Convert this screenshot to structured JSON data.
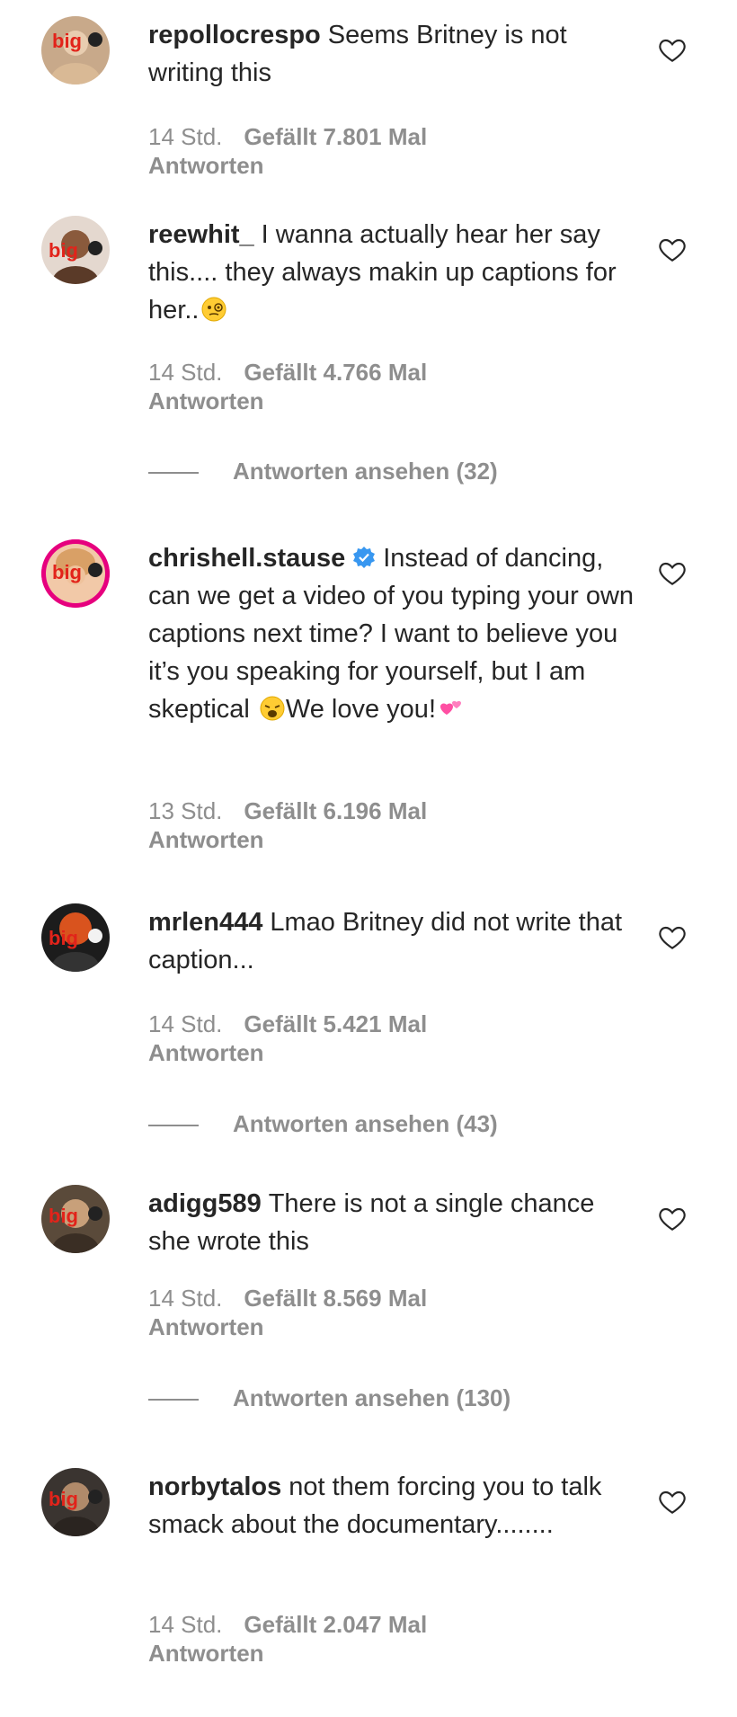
{
  "comments": [
    {
      "username": "repollocrespo",
      "text": "Seems Britney is not writing this",
      "time": "14 Std.",
      "likes": "Gefällt 7.801 Mal",
      "reply_label": "Antworten",
      "avatar_text": "big"
    },
    {
      "username": "reewhit_",
      "text": "I wanna actually hear her say this.... they always makin up captions for her..",
      "time": "14 Std.",
      "likes": "Gefällt 4.766 Mal",
      "reply_label": "Antworten",
      "view_replies": "Antworten ansehen (32)",
      "avatar_text": "big"
    },
    {
      "username": "chrishell.stause",
      "text_a": "Instead of dancing, can we get a video of you typing your own captions next time? I want to believe you it’s you speaking for yourself, but I am skeptical",
      "text_b": "We love you!",
      "time": "13 Std.",
      "likes": "Gefällt 6.196 Mal",
      "reply_label": "Antworten",
      "avatar_text": "big"
    },
    {
      "username": "mrlen444",
      "text": "Lmao Britney did not write that caption...",
      "time": "14 Std.",
      "likes": "Gefällt 5.421 Mal",
      "reply_label": "Antworten",
      "view_replies": "Antworten ansehen (43)",
      "avatar_text": "big"
    },
    {
      "username": "adigg589",
      "text": "There is not a single chance she wrote this",
      "time": "14 Std.",
      "likes": "Gefällt 8.569 Mal",
      "reply_label": "Antworten",
      "view_replies": "Antworten ansehen (130)",
      "avatar_text": "big"
    },
    {
      "username": "norbytalos",
      "text": "not them forcing you to talk smack about the documentary........",
      "time": "14 Std.",
      "likes": "Gefällt 2.047 Mal",
      "reply_label": "Antworten",
      "avatar_text": "big"
    }
  ],
  "colors": {
    "text": "#262626",
    "secondary": "#8e8e8e",
    "verified": "#3897f0",
    "story_ring": "#e6007e",
    "logo_red": "#e2231a"
  },
  "icons": {
    "like": "heart-outline-icon",
    "verified": "verified-badge-icon"
  }
}
